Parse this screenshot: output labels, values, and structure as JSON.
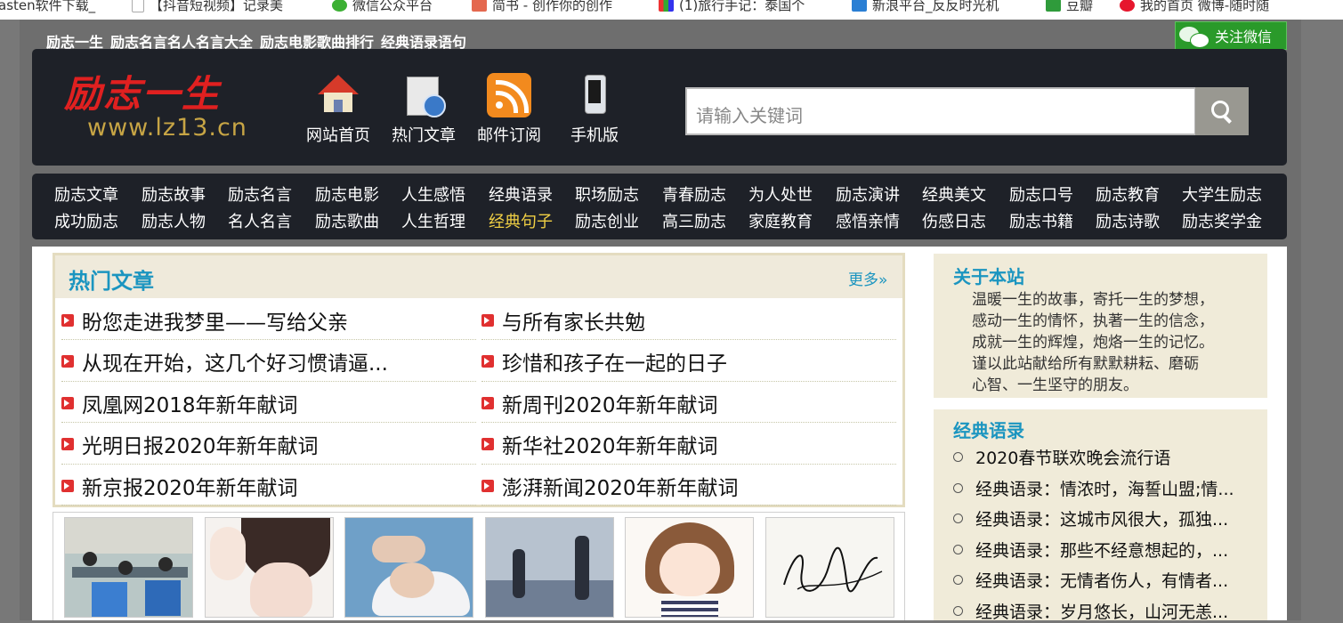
{
  "bookmarks": [
    {
      "label": "asten软件下载_",
      "icon": "none"
    },
    {
      "label": "【抖音短视频】记录美",
      "icon": "page-icon"
    },
    {
      "label": "微信公众平台",
      "icon": "wechat-icon"
    },
    {
      "label": "简书 - 创作你的创作",
      "icon": "jianshu-icon"
    },
    {
      "label": "(1)旅行手记：泰国个",
      "icon": "mosaic-icon"
    },
    {
      "label": "新浪平台_反反时光机",
      "icon": "sina-icon"
    },
    {
      "label": "豆瓣",
      "icon": "douban-icon"
    },
    {
      "label": "我的首页 微博-随时随",
      "icon": "weibo-icon"
    }
  ],
  "site": {
    "title": "励志一生_励志名言名人名言大全_励志电影歌曲排行_经典语录语句",
    "wechat_button": "关注微信",
    "logo_text": "励志一生",
    "logo_url": "www.lz13.cn"
  },
  "topnav": [
    {
      "label": "网站首页",
      "icon": "home-icon"
    },
    {
      "label": "热门文章",
      "icon": "news-globe-icon"
    },
    {
      "label": "邮件订阅",
      "icon": "rss-icon"
    },
    {
      "label": "手机版",
      "icon": "phone-icon"
    }
  ],
  "search": {
    "placeholder": "请输入关键词",
    "button_icon": "search-icon"
  },
  "categories": {
    "row1": [
      "励志文章",
      "励志故事",
      "励志名言",
      "励志电影",
      "人生感悟",
      "经典语录",
      "职场励志",
      "青春励志",
      "为人处世",
      "励志演讲",
      "经典美文",
      "励志口号",
      "励志教育",
      "大学生励志"
    ],
    "row2": [
      "成功励志",
      "励志人物",
      "名人名言",
      "励志歌曲",
      "人生哲理",
      "经典句子",
      "励志创业",
      "高三励志",
      "家庭教育",
      "感悟亲情",
      "伤感日志",
      "励志书籍",
      "励志诗歌",
      "励志奖学金"
    ],
    "active": "经典句子"
  },
  "hot": {
    "title": "热门文章",
    "more": "更多»",
    "items": [
      "盼您走进我梦里——写给父亲",
      "与所有家长共勉",
      "从现在开始，这几个好习惯请逼...",
      "珍惜和孩子在一起的日子",
      "凤凰网2018年新年献词",
      "新周刊2020年新年献词",
      "光明日报2020年新年献词",
      "新华社2020年新年献词",
      "新京报2020年新年献词",
      "澎湃新闻2020年新年献词"
    ]
  },
  "thumbs": [
    "classroom-photo",
    "crying-boy-drawing",
    "pregnant-woman-photo",
    "rain-sketch",
    "girl-drawing",
    "signature-image"
  ],
  "about": {
    "title": "关于本站",
    "lines": [
      "温暖一生的故事，寄托一生的梦想，",
      "感动一生的情怀，执著一生的信念，",
      "成就一生的辉煌，炮烙一生的记忆。",
      "谨以此站献给所有默默耕耘、磨砺",
      " 心智、一生坚守的朋友。"
    ]
  },
  "quotes": {
    "title": "经典语录",
    "items": [
      "2020春节联欢晚会流行语",
      "经典语录：情浓时，海誓山盟;情...",
      "经典语录：这城市风很大，孤独...",
      "经典语录：那些不经意想起的，...",
      "经典语录：无情者伤人，有情者...",
      "经典语录：岁月悠长，山河无恙..."
    ]
  }
}
